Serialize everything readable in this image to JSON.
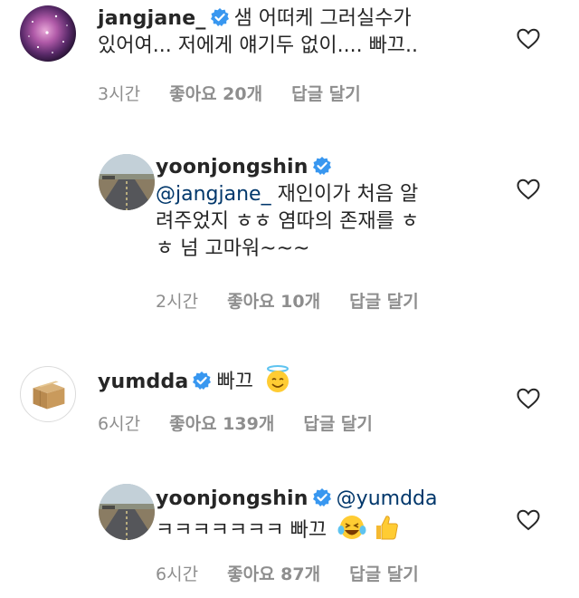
{
  "comments": [
    {
      "username": "jangjane_",
      "mention": "",
      "text_line1": "샘 어떠케 그러실수가",
      "text_line2": "있어여... 저에게 얘기두 없이.... 빠끄..",
      "text_line3": "",
      "time": "3시간",
      "likes": "좋아요 20개",
      "reply": "답글 달기",
      "avatar_icon": "galaxy-avatar-icon"
    },
    {
      "username": "yoonjongshin",
      "mention": "@jangjane_",
      "text_line1": " 재인이가 처음 알",
      "text_line2": "려주었지 ㅎㅎ 염따의 존재를 ㅎ",
      "text_line3": "ㅎ 넘 고마워~~~",
      "time": "2시간",
      "likes": "좋아요 10개",
      "reply": "답글 달기",
      "avatar_icon": "road-avatar-icon"
    },
    {
      "username": "yumdda",
      "mention": "",
      "text_line1": "빠끄",
      "emoji": "smiling-face-with-halo-emoji",
      "time": "6시간",
      "likes": "좋아요 139개",
      "reply": "답글 달기",
      "avatar_icon": "cardboard-box-avatar-icon"
    },
    {
      "username": "yoonjongshin",
      "mention": "@yumdda",
      "text_line1": "ㅋㅋㅋㅋㅋㅋㅋ 빠끄",
      "emoji": "laughing-tears-emoji",
      "emoji2": "thumbs-up-emoji",
      "time": "6시간",
      "likes": "좋아요 87개",
      "reply": "답글 달기",
      "avatar_icon": "road-avatar-icon"
    }
  ],
  "colors": {
    "text": "#262626",
    "meta": "#8e8e8e",
    "verified": "#3897f0",
    "mention": "#00376b"
  },
  "icons": {
    "verified": "verified-badge-icon",
    "like": "heart-outline-icon"
  }
}
